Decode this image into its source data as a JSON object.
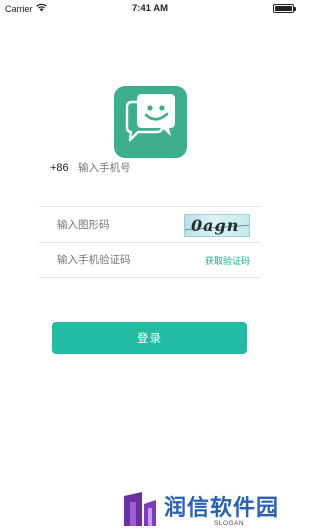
{
  "status_bar": {
    "carrier": "Carrier",
    "time": "7:41 AM",
    "icons": [
      "wifi-icon",
      "battery-icon"
    ]
  },
  "logo": {
    "icon": "chat-smile-icon",
    "color": "#3fae8c"
  },
  "form": {
    "country_code": "+86",
    "phone_placeholder": "输入手机号",
    "captcha_placeholder": "输入图形码",
    "captcha_text": "0agn",
    "sms_placeholder": "输入手机验证码",
    "sms_link_label": "获取验证码"
  },
  "login_button_label": "登录",
  "watermark": {
    "brand": "润信软件园",
    "slogan": "SLOGAN"
  },
  "colors": {
    "accent": "#22bba3",
    "link": "#1ea88a",
    "divider": "#e6e6e6",
    "placeholder": "#9a9a9a"
  }
}
